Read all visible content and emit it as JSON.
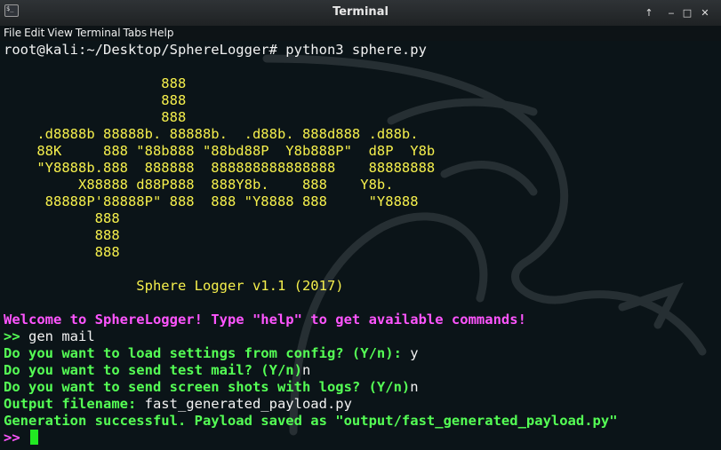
{
  "window": {
    "title": "Terminal",
    "icon": "terminal-icon",
    "controls": {
      "up": "↑",
      "minimize": "‒",
      "maximize": "□",
      "close": "✕"
    }
  },
  "menu": [
    "File",
    "Edit",
    "View",
    "Terminal",
    "Tabs",
    "Help"
  ],
  "colors": {
    "background": "#0b1418",
    "banner": "#f5ef4c",
    "welcome": "#ff55ff",
    "prompt": "#55ff55",
    "cursor": "#22e822"
  },
  "terminal": {
    "command_line": "root@kali:~/Desktop/SphereLogger# python3 sphere.py",
    "banner": [
      "",
      "                   888",
      "                   888",
      "                   888",
      "    .d8888b 88888b. 88888b.  .d88b. 888d888 .d88b.",
      "    88K     888 \"88b888 \"88bd88P  Y8b888P\"  d8P  Y8b",
      "    \"Y8888b.888  888888  888888888888888    88888888",
      "         X88888 d88P888  888Y8b.    888    Y8b.",
      "     88888P'88888P\" 888  888 \"Y8888 888     \"Y8888",
      "           888",
      "           888",
      "           888",
      "",
      "                Sphere Logger v1.1 (2017)",
      ""
    ],
    "welcome": "Welcome to SphereLogger! Type \"help\" to get available commands!",
    "prompt_symbol": ">> ",
    "session": [
      {
        "prompt": ">> ",
        "input": "gen mail"
      },
      {
        "prompt": "Do you want to load settings from config? (Y/n): ",
        "input": "y"
      },
      {
        "prompt": "Do you want to send test mail? (Y/n)",
        "input": "n"
      },
      {
        "prompt": "Do you want to send screen shots with logs? (Y/n)",
        "input": "n"
      },
      {
        "prompt": "Output filename: ",
        "input": "fast_generated_payload.py"
      },
      {
        "prompt": "Generation successful. Payload saved as \"output/fast_generated_payload.py\"",
        "input": ""
      }
    ],
    "final_prompt": ">> "
  }
}
